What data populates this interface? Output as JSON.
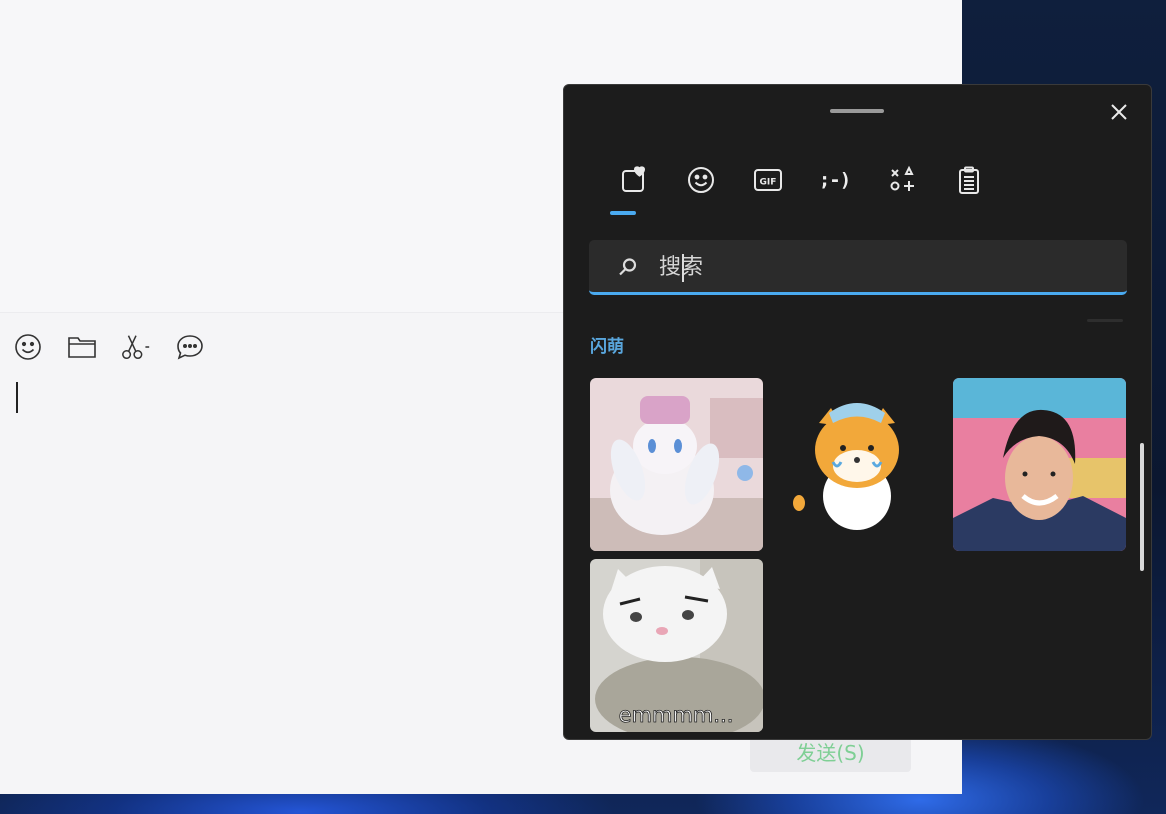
{
  "chat": {
    "toolbar": [
      {
        "name": "emoji-button",
        "icon": "smiley-icon"
      },
      {
        "name": "file-button",
        "icon": "folder-icon"
      },
      {
        "name": "screenshot-button",
        "icon": "scissors-icon"
      },
      {
        "name": "chat-history-button",
        "icon": "speech-bubble-icon"
      }
    ],
    "send_label": "发送(S)"
  },
  "emoji_panel": {
    "tabs": [
      {
        "name": "tab-favorites",
        "icon": "heart-card-icon",
        "selected": true
      },
      {
        "name": "tab-emoji",
        "icon": "smiley-icon"
      },
      {
        "name": "tab-gif",
        "icon": "gif-icon",
        "text": "GIF"
      },
      {
        "name": "tab-kaomoji",
        "icon": "kaomoji-icon",
        "text": ";-)"
      },
      {
        "name": "tab-symbols",
        "icon": "symbols-icon"
      },
      {
        "name": "tab-clipboard",
        "icon": "clipboard-icon"
      }
    ],
    "search": {
      "placeholder": "搜索",
      "value": ""
    },
    "section_title": "闪萌",
    "gifs": [
      {
        "name": "gif-white-bunny",
        "caption": ""
      },
      {
        "name": "gif-shiba-sticker",
        "caption": ""
      },
      {
        "name": "gif-smiling-man",
        "caption": ""
      },
      {
        "name": "gif-white-cat",
        "caption": "emmmm..."
      }
    ],
    "accent_color": "#4aaaf0"
  }
}
